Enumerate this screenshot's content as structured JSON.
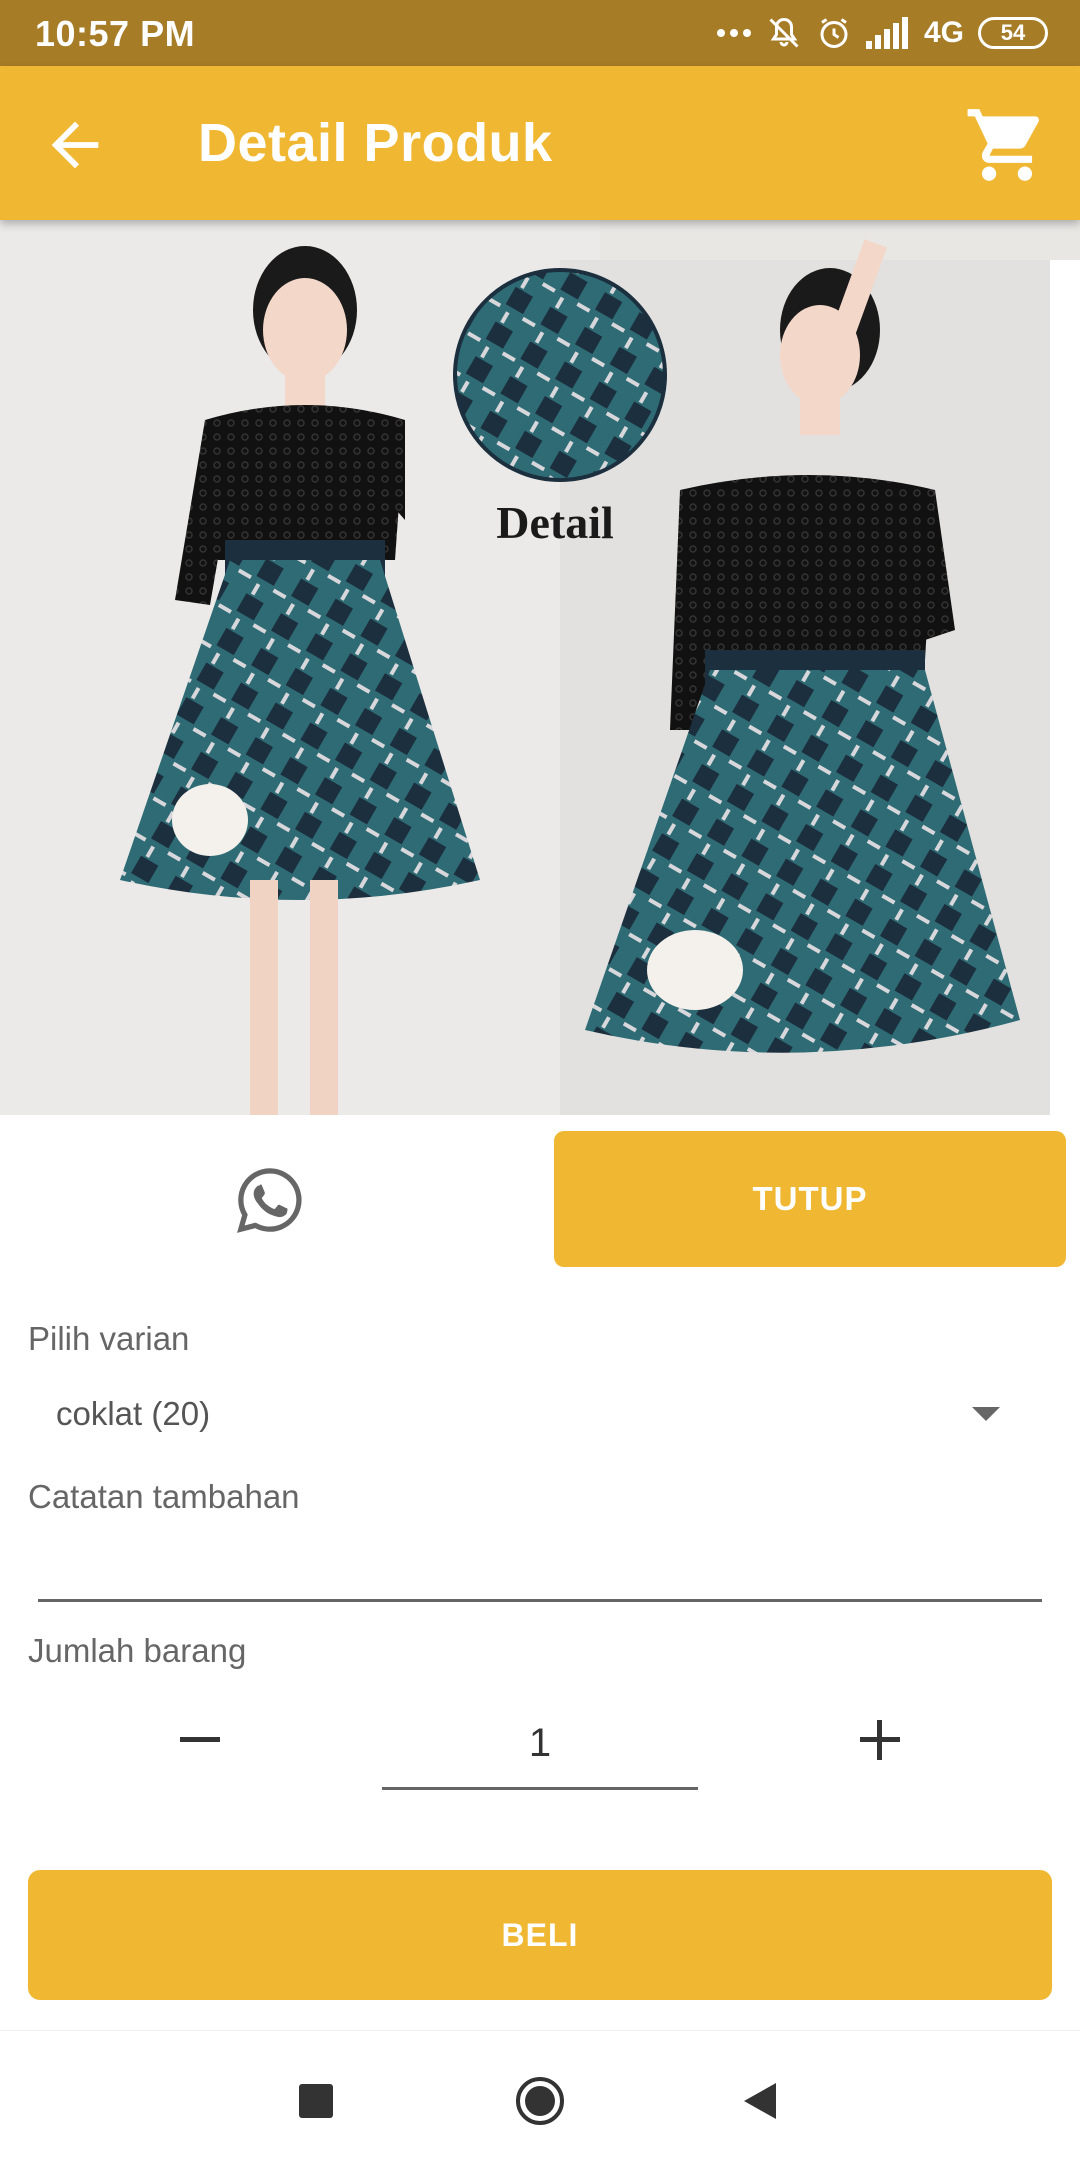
{
  "status_bar": {
    "time": "10:57 PM",
    "network": "4G",
    "battery": "54",
    "icons": [
      "more-dots-icon",
      "mute-icon",
      "alarm-icon",
      "signal-icon",
      "battery-icon"
    ]
  },
  "app_bar": {
    "title": "Detail Produk",
    "back_icon": "arrow-back-icon",
    "cart_icon": "cart-icon"
  },
  "product": {
    "image_caption": "Detail"
  },
  "actions": {
    "whatsapp_icon": "whatsapp-icon",
    "close_label": "TUTUP"
  },
  "form": {
    "variant_label": "Pilih varian",
    "variant_value": "coklat (20)",
    "note_label": "Catatan tambahan",
    "note_value": "",
    "qty_label": "Jumlah barang",
    "qty_value": "1",
    "buy_label": "BELI"
  },
  "colors": {
    "accent": "#f0b733",
    "status_bar": "#a67c26"
  }
}
